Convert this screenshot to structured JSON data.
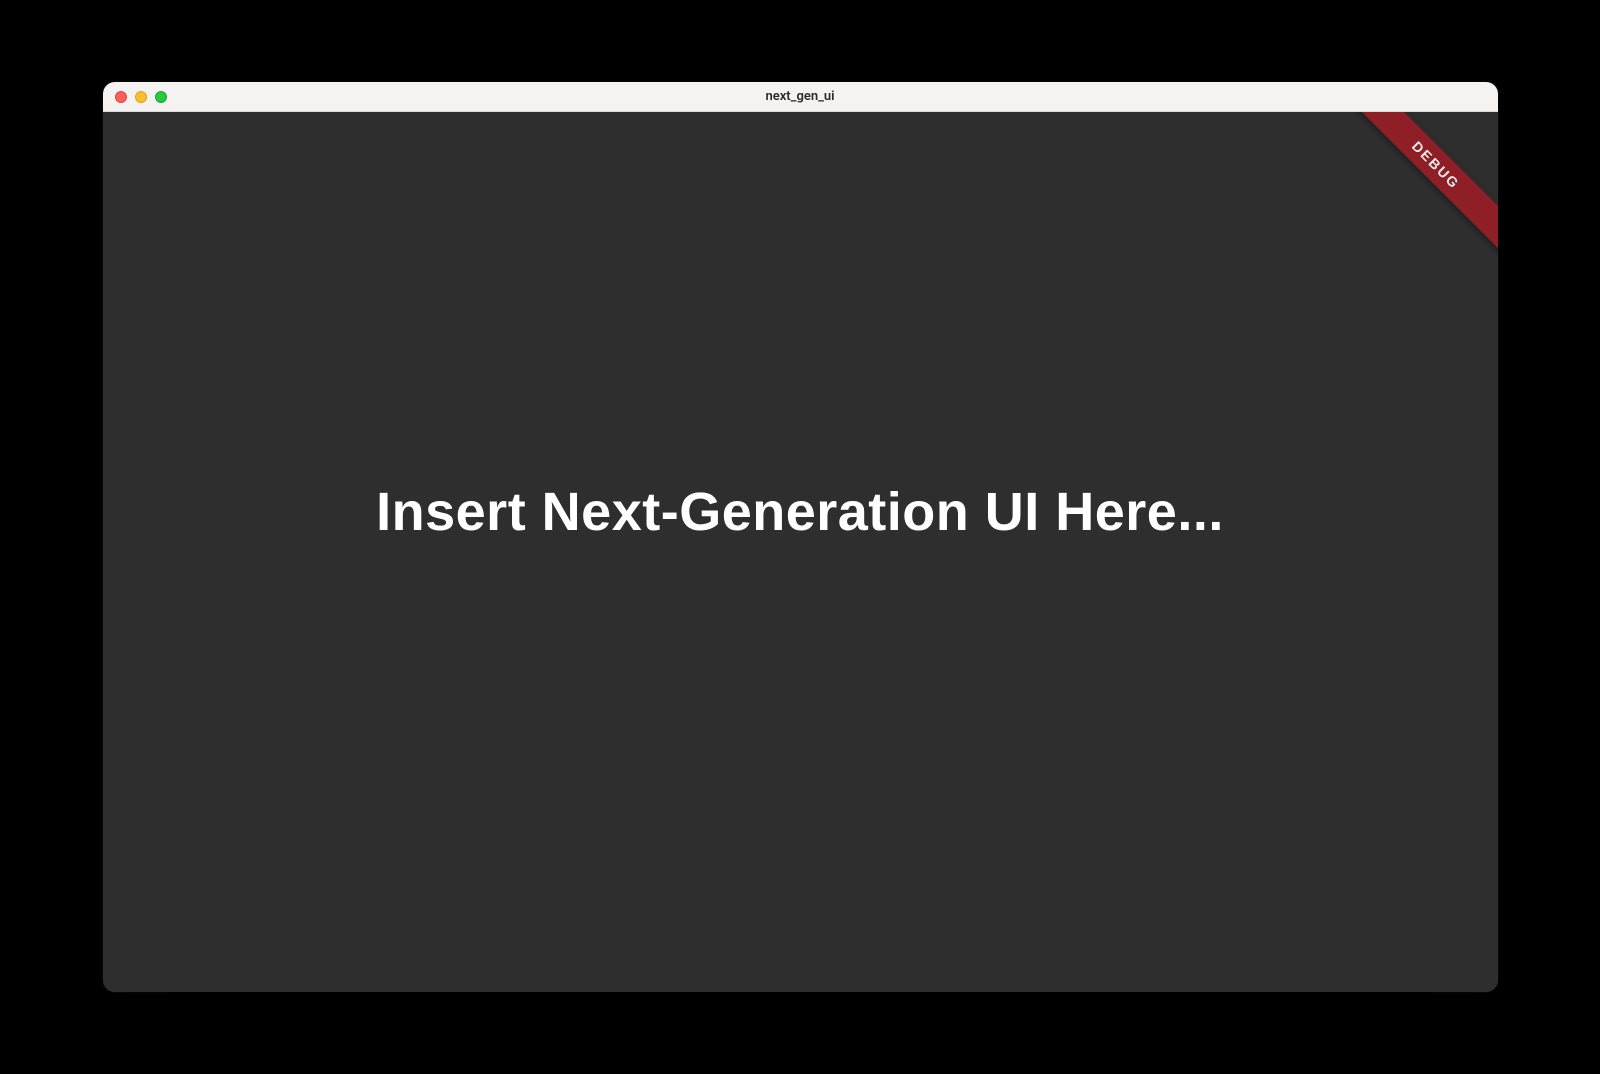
{
  "window": {
    "title": "next_gen_ui"
  },
  "content": {
    "headline": "Insert Next-Generation UI Here..."
  },
  "debug_banner": {
    "label": "DEBUG"
  }
}
